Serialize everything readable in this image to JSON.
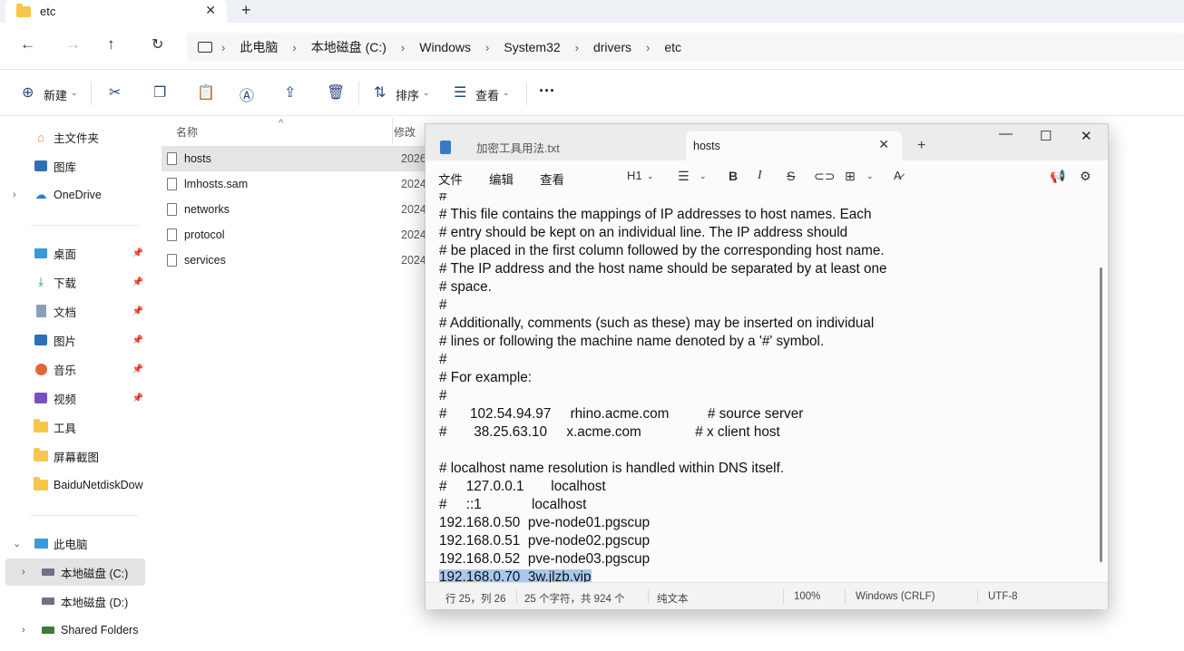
{
  "explorer": {
    "tab_title": "etc",
    "breadcrumb": [
      "此电脑",
      "本地磁盘 (C:)",
      "Windows",
      "System32",
      "drivers",
      "etc"
    ],
    "toolbar": {
      "new_label": "新建",
      "sort_label": "排序",
      "view_label": "查看",
      "more_label": "···"
    },
    "sidebar": {
      "home": "主文件夹",
      "gallery": "图库",
      "onedrive": "OneDrive",
      "quick": [
        "桌面",
        "下载",
        "文档",
        "图片",
        "音乐",
        "视频",
        "工具",
        "屏幕截图",
        "BaiduNetdiskDow"
      ],
      "thispc": "此电脑",
      "drive_c": "本地磁盘 (C:)",
      "drive_d": "本地磁盘 (D:)",
      "shared": "Shared Folders"
    },
    "columns": {
      "name": "名称",
      "modified": "修改"
    },
    "files": [
      {
        "name": "hosts",
        "date": "2026"
      },
      {
        "name": "lmhosts.sam",
        "date": "2024"
      },
      {
        "name": "networks",
        "date": "2024"
      },
      {
        "name": "protocol",
        "date": "2024"
      },
      {
        "name": "services",
        "date": "2024"
      }
    ]
  },
  "notepad": {
    "tab1": "加密工具用法.txt",
    "tab2": "hosts",
    "menu": {
      "file": "文件",
      "edit": "编辑",
      "view": "查看",
      "heading": "H1"
    },
    "lines": [
      "#",
      "# This file contains the mappings of IP addresses to host names. Each",
      "# entry should be kept on an individual line. The IP address should",
      "# be placed in the first column followed by the corresponding host name.",
      "# The IP address and the host name should be separated by at least one",
      "# space.",
      "#",
      "# Additionally, comments (such as these) may be inserted on individual",
      "# lines or following the machine name denoted by a '#' symbol.",
      "#",
      "# For example:",
      "#",
      "#      102.54.94.97     rhino.acme.com          # source server",
      "#       38.25.63.10     x.acme.com              # x client host",
      "",
      "# localhost name resolution is handled within DNS itself.",
      "#     127.0.0.1       localhost",
      "#     ::1             localhost",
      "192.168.0.50  pve-node01.pgscup",
      "192.168.0.51  pve-node02.pgscup",
      "192.168.0.52  pve-node03.pgscup"
    ],
    "selected_line": "192.168.0.70  3w.jlzb.vip",
    "status": {
      "position": "行 25，列 26",
      "count": "25 个字符，共 924 个",
      "format": "纯文本",
      "zoom": "100%",
      "eol": "Windows (CRLF)",
      "encoding": "UTF-8"
    }
  }
}
